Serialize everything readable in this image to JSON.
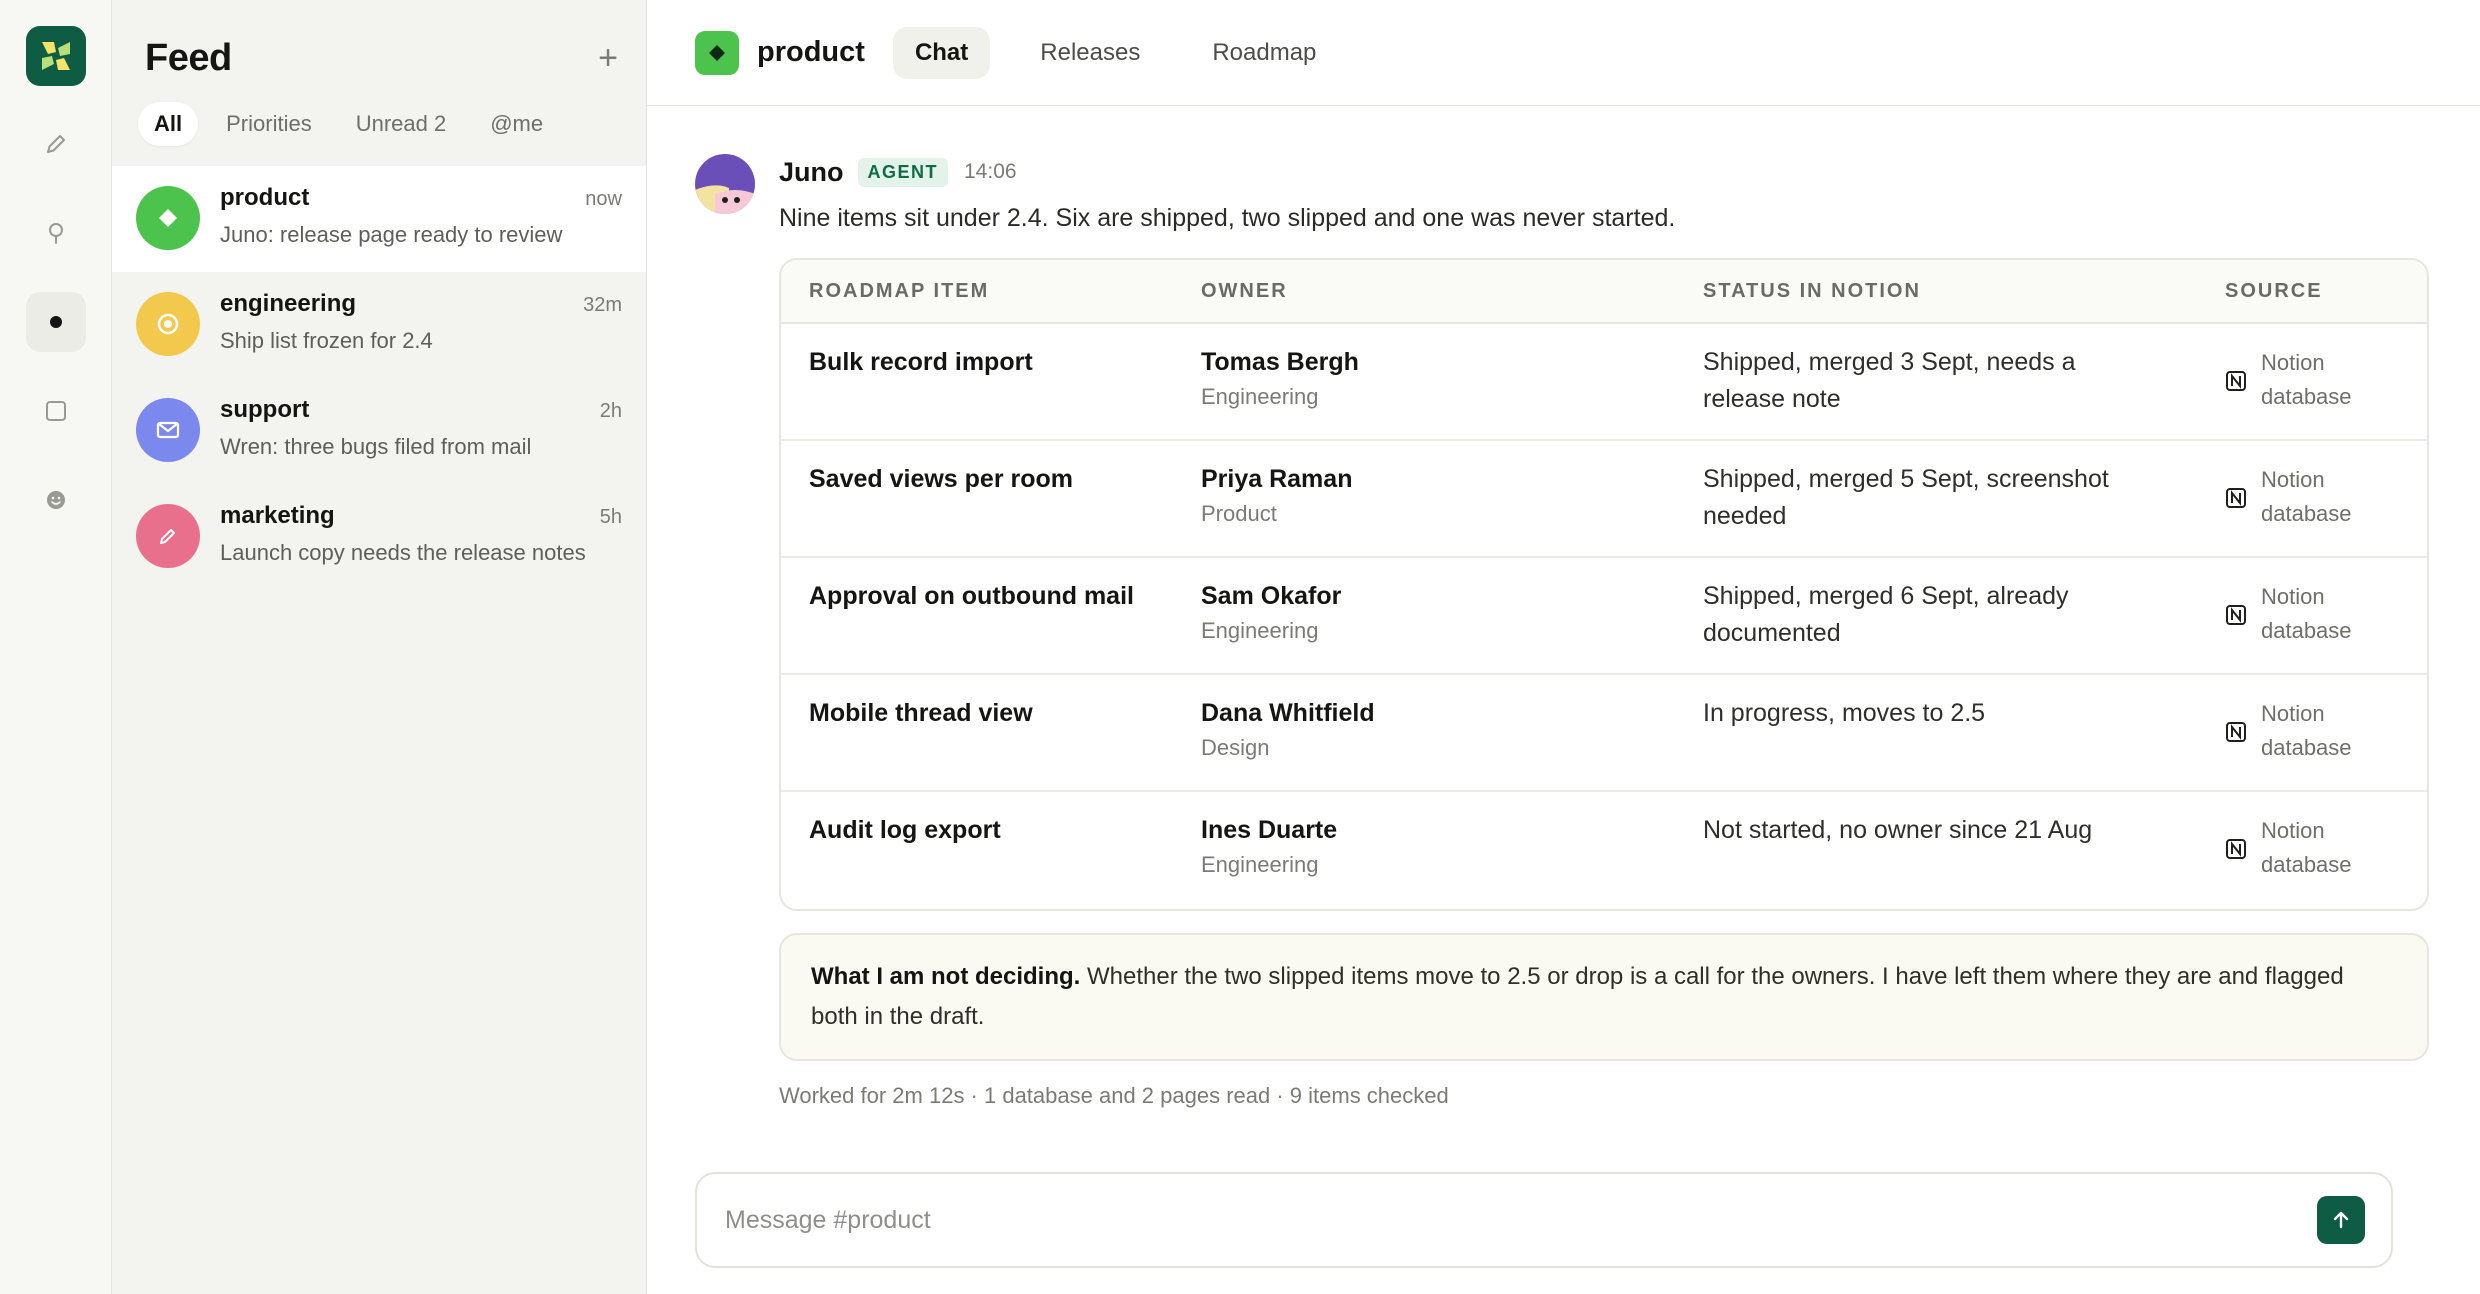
{
  "feed": {
    "title": "Feed",
    "add_label": "+",
    "filters": [
      "All",
      "Priorities",
      "Unread 2",
      "@me"
    ],
    "conversations": [
      {
        "name": "product",
        "time": "now",
        "preview": "Juno: release page ready to review",
        "color": "#4cc34d",
        "icon": "diamond-icon"
      },
      {
        "name": "engineering",
        "time": "32m",
        "preview": "Ship list frozen for 2.4",
        "color": "#f2c94c",
        "icon": "target-icon"
      },
      {
        "name": "support",
        "time": "2h",
        "preview": "Wren: three bugs filed from mail",
        "color": "#7b88ee",
        "icon": "mail-icon"
      },
      {
        "name": "marketing",
        "time": "5h",
        "preview": "Launch copy needs the release notes",
        "color": "#e9708c",
        "icon": "pencil-icon"
      }
    ]
  },
  "channel": {
    "name": "product",
    "tabs": [
      "Chat",
      "Releases",
      "Roadmap"
    ]
  },
  "message": {
    "author": "Juno",
    "badge": "AGENT",
    "time": "14:06",
    "text": "Nine items sit under 2.4. Six are shipped, two slipped and one was never started.",
    "table": {
      "headers": [
        "ROADMAP ITEM",
        "OWNER",
        "STATUS IN NOTION",
        "SOURCE"
      ],
      "rows": [
        {
          "item": "Bulk record import",
          "owner": "Tomas Bergh",
          "team": "Engineering",
          "status": "Shipped, merged 3 Sept, needs a release note",
          "source_line1": "Notion",
          "source_line2": "database"
        },
        {
          "item": "Saved views per room",
          "owner": "Priya Raman",
          "team": "Product",
          "status": "Shipped, merged 5 Sept, screenshot needed",
          "source_line1": "Notion",
          "source_line2": "database"
        },
        {
          "item": "Approval on outbound mail",
          "owner": "Sam Okafor",
          "team": "Engineering",
          "status": "Shipped, merged 6 Sept, already documented",
          "source_line1": "Notion",
          "source_line2": "database"
        },
        {
          "item": "Mobile thread view",
          "owner": "Dana Whitfield",
          "team": "Design",
          "status": "In progress, moves to 2.5",
          "source_line1": "Notion",
          "source_line2": "database"
        },
        {
          "item": "Audit log export",
          "owner": "Ines Duarte",
          "team": "Engineering",
          "status": "Not started, no owner since 21 Aug",
          "source_line1": "Notion",
          "source_line2": "database"
        }
      ]
    },
    "note_bold": "What I am not deciding.",
    "note_text": " Whether the two slipped items move to 2.5 or drop is a call for the owners. I have left them where they are and flagged both in the draft.",
    "worked": "Worked for 2m 12s · 1 database and 2 pages read · 9 items checked"
  },
  "composer": {
    "placeholder": "Message #product"
  },
  "colors": {
    "brand": "#0d5c43",
    "channel": "#4cc34d",
    "agent_badge_bg": "#e3f3ea",
    "agent_badge_text": "#0f6a48"
  }
}
